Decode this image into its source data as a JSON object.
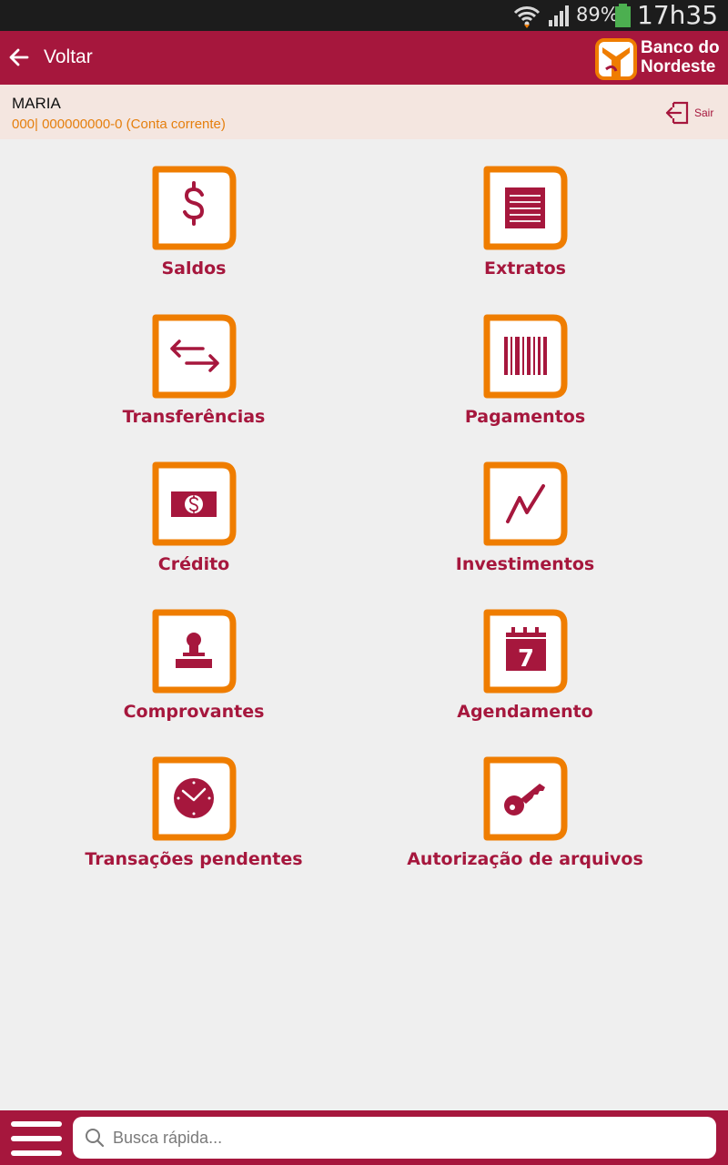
{
  "status_bar": {
    "battery_percent": "89%",
    "time": "17h35"
  },
  "app_bar": {
    "back_label": "Voltar",
    "brand_line1": "Banco do",
    "brand_line2": "Nordeste"
  },
  "account": {
    "name": "MARIA",
    "number": "000| 000000000-0 (Conta corrente)",
    "logout_label": "Sair"
  },
  "menu": {
    "items": [
      {
        "label": "Saldos",
        "icon": "dollar-icon"
      },
      {
        "label": "Extratos",
        "icon": "statement-icon"
      },
      {
        "label": "Transferências",
        "icon": "transfer-arrows-icon"
      },
      {
        "label": "Pagamentos",
        "icon": "barcode-icon"
      },
      {
        "label": "Crédito",
        "icon": "banknote-icon"
      },
      {
        "label": "Investimentos",
        "icon": "trend-line-icon"
      },
      {
        "label": "Comprovantes",
        "icon": "stamp-icon"
      },
      {
        "label": "Agendamento",
        "icon": "calendar-icon"
      },
      {
        "label": "Transações pendentes",
        "icon": "clock-icon"
      },
      {
        "label": "Autorização de arquivos",
        "icon": "key-icon"
      }
    ]
  },
  "calendar_day": "7",
  "search": {
    "placeholder": "Busca rápida..."
  },
  "colors": {
    "brand": "#a6173d",
    "accent": "#ef7d00",
    "account_bg": "#f4e6e0",
    "background": "#efefef"
  }
}
